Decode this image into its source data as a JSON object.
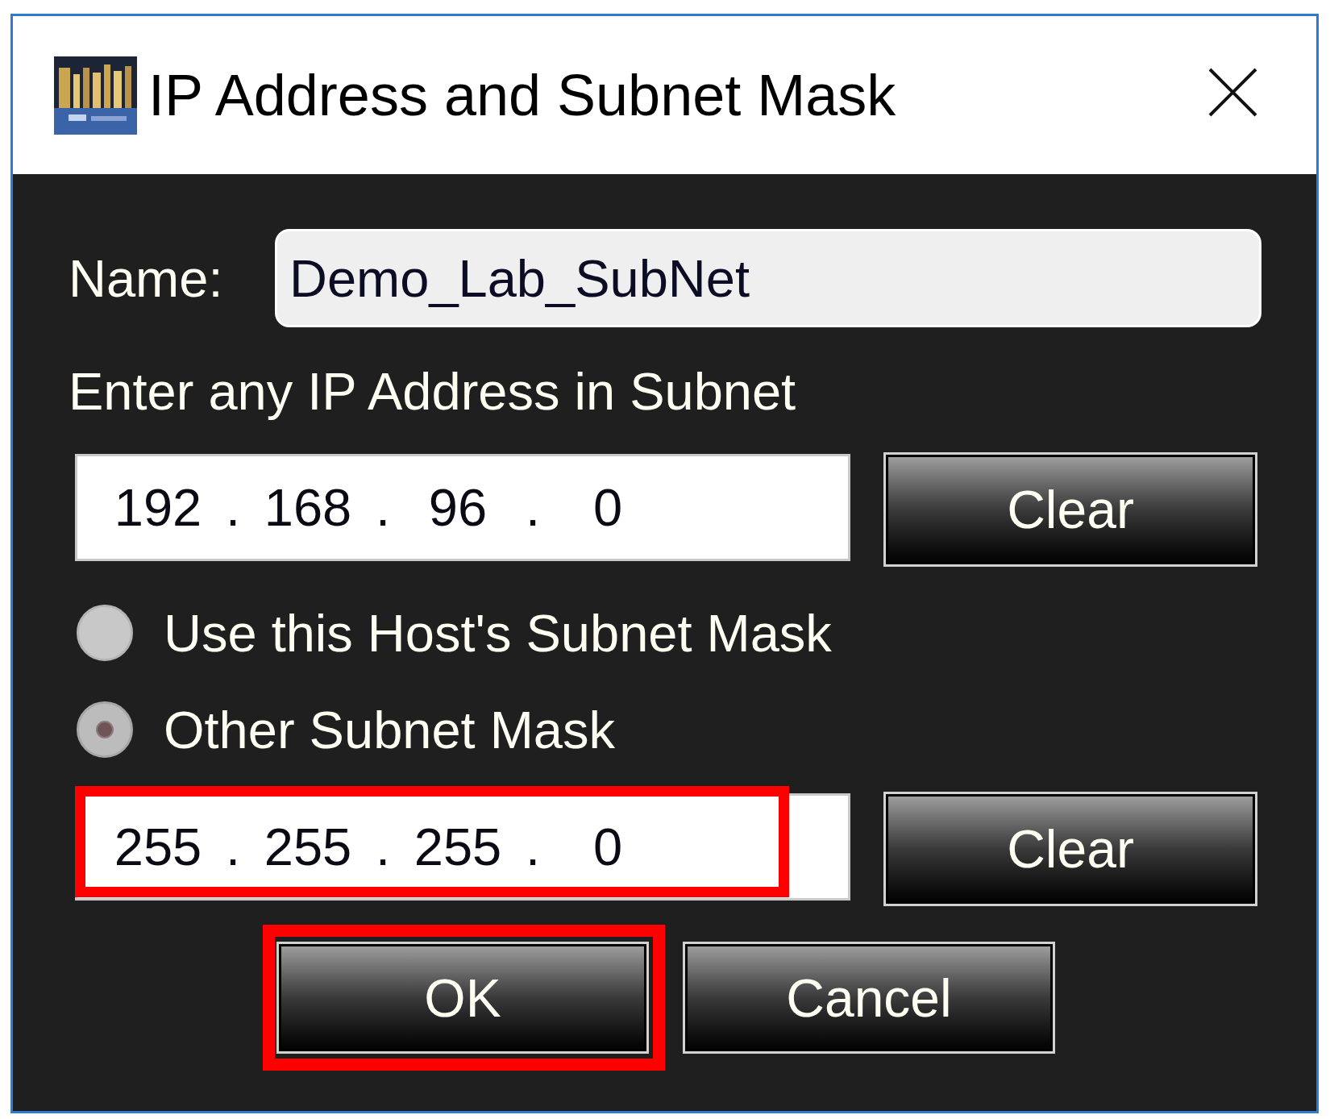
{
  "window": {
    "title": "IP Address and Subnet Mask"
  },
  "name": {
    "label": "Name:",
    "value": "Demo_Lab_SubNet"
  },
  "ip_address": {
    "label": "Enter any IP Address in Subnet",
    "octets": [
      "192",
      "168",
      "96",
      "0"
    ],
    "separators": [
      ".",
      ".",
      "."
    ],
    "clear_button": "Clear",
    "highlighted": false
  },
  "mask_options": [
    {
      "label": "Use this Host's Subnet Mask",
      "selected": false
    },
    {
      "label": "Other Subnet Mask",
      "selected": true
    }
  ],
  "subnet_mask": {
    "octets": [
      "255",
      "255",
      "255",
      "0"
    ],
    "separators": [
      ".",
      ".",
      "."
    ],
    "clear_button": "Clear",
    "highlighted": true
  },
  "buttons": [
    {
      "label": "OK",
      "highlighted": true
    },
    {
      "label": "Cancel",
      "highlighted": false
    }
  ]
}
